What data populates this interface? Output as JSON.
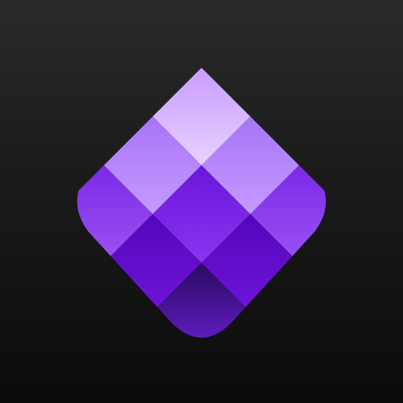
{
  "app_icon": {
    "name": "diamond-grid-logo",
    "background_colors": [
      "#2a2a2a",
      "#0b0b0b"
    ],
    "tile_colors": {
      "top": [
        "#e6ccff",
        "#c79bff"
      ],
      "upper_left": [
        "#c9a0ff",
        "#a672f7"
      ],
      "upper_right": [
        "#c9a0ff",
        "#a672f7"
      ],
      "left": [
        "#9b4cf2",
        "#7a2ae6"
      ],
      "center": [
        "#8a2cf0",
        "#6b16dc"
      ],
      "right": [
        "#9b4cf2",
        "#7a2ae6"
      ],
      "lower_left": [
        "#6a10d6",
        "#5208b8"
      ],
      "lower_right": [
        "#6a10d6",
        "#5208b8"
      ],
      "bottom": [
        "#2a0a5e",
        "#6a1cd6"
      ]
    }
  }
}
